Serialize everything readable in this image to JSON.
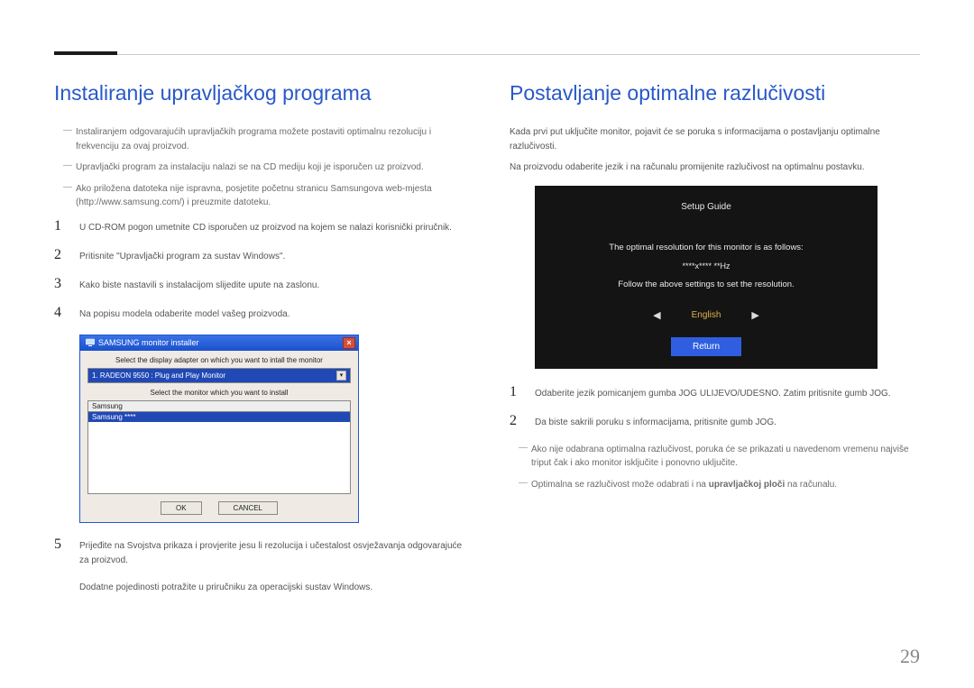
{
  "pageNumber": "29",
  "left": {
    "heading": "Instaliranje upravljačkog programa",
    "notes": [
      "Instaliranjem odgovarajućih upravljačkih programa možete postaviti optimalnu rezoluciju i frekvenciju za ovaj proizvod.",
      "Upravljački program za instalaciju nalazi se na CD mediju koji je isporučen uz proizvod.",
      "Ako priložena datoteka nije ispravna, posjetite početnu stranicu Samsungova web-mjesta (http://www.samsung.com/) i preuzmite datoteku."
    ],
    "steps": {
      "1": "U CD-ROM pogon umetnite CD isporučen uz proizvod na kojem se nalazi korisnički priručnik.",
      "2": "Pritisnite \"Upravljački program za sustav Windows\".",
      "3": "Kako biste nastavili s instalacijom slijedite upute na zaslonu.",
      "4": "Na popisu modela odaberite model vašeg proizvoda.",
      "5": "Prijeđite na Svojstva prikaza i provjerite jesu li rezolucija i učestalost osvježavanja odgovarajuće za proizvod."
    },
    "afterStep5": "Dodatne pojedinosti potražite u priručniku za operacijski sustav Windows.",
    "installer": {
      "title": "SAMSUNG monitor installer",
      "label1": "Select the display adapter on which you want to intall the monitor",
      "dropdownValue": "1. RADEON 9550 : Plug and Play Monitor",
      "label2": "Select the monitor which you want to install",
      "listHeader": "Samsung",
      "listSelected": "Samsung ****",
      "okLabel": "OK",
      "cancelLabel": "CANCEL"
    }
  },
  "right": {
    "heading": "Postavljanje optimalne razlučivosti",
    "intro1": "Kada prvi put uključite monitor, pojavit će se poruka s informacijama o postavljanju optimalne razlučivosti.",
    "intro2": "Na proizvodu odaberite jezik i na računalu promijenite razlučivost na optimalnu postavku.",
    "osd": {
      "title": "Setup Guide",
      "line1": "The optimal resolution for this monitor is as follows:",
      "resVal": "****x**** **Hz",
      "line2": "Follow the above settings to set the resolution.",
      "language": "English",
      "returnLabel": "Return"
    },
    "steps": {
      "1": "Odaberite jezik pomicanjem gumba JOG ULIJEVO/UDESNO. Zatim pritisnite gumb JOG.",
      "2": "Da biste sakrili poruku s informacijama, pritisnite gumb JOG."
    },
    "notes": [
      "Ako nije odabrana optimalna razlučivost, poruka će se prikazati u navedenom vremenu najviše triput čak i ako monitor isključite i ponovno uključite."
    ],
    "note2_prefix": "Optimalna se razlučivost može odabrati i na ",
    "note2_bold": "upravljačkoj ploči",
    "note2_suffix": " na računalu."
  }
}
